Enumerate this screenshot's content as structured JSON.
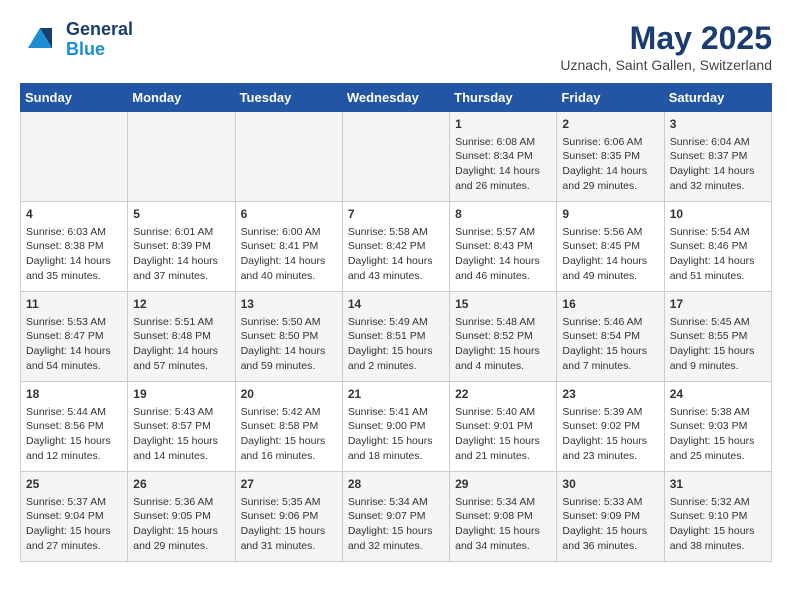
{
  "header": {
    "logo_line1": "General",
    "logo_line2": "Blue",
    "title": "May 2025",
    "subtitle": "Uznach, Saint Gallen, Switzerland"
  },
  "days_of_week": [
    "Sunday",
    "Monday",
    "Tuesday",
    "Wednesday",
    "Thursday",
    "Friday",
    "Saturday"
  ],
  "weeks": [
    [
      {
        "day": "",
        "content": ""
      },
      {
        "day": "",
        "content": ""
      },
      {
        "day": "",
        "content": ""
      },
      {
        "day": "",
        "content": ""
      },
      {
        "day": "1",
        "content": "Sunrise: 6:08 AM\nSunset: 8:34 PM\nDaylight: 14 hours\nand 26 minutes."
      },
      {
        "day": "2",
        "content": "Sunrise: 6:06 AM\nSunset: 8:35 PM\nDaylight: 14 hours\nand 29 minutes."
      },
      {
        "day": "3",
        "content": "Sunrise: 6:04 AM\nSunset: 8:37 PM\nDaylight: 14 hours\nand 32 minutes."
      }
    ],
    [
      {
        "day": "4",
        "content": "Sunrise: 6:03 AM\nSunset: 8:38 PM\nDaylight: 14 hours\nand 35 minutes."
      },
      {
        "day": "5",
        "content": "Sunrise: 6:01 AM\nSunset: 8:39 PM\nDaylight: 14 hours\nand 37 minutes."
      },
      {
        "day": "6",
        "content": "Sunrise: 6:00 AM\nSunset: 8:41 PM\nDaylight: 14 hours\nand 40 minutes."
      },
      {
        "day": "7",
        "content": "Sunrise: 5:58 AM\nSunset: 8:42 PM\nDaylight: 14 hours\nand 43 minutes."
      },
      {
        "day": "8",
        "content": "Sunrise: 5:57 AM\nSunset: 8:43 PM\nDaylight: 14 hours\nand 46 minutes."
      },
      {
        "day": "9",
        "content": "Sunrise: 5:56 AM\nSunset: 8:45 PM\nDaylight: 14 hours\nand 49 minutes."
      },
      {
        "day": "10",
        "content": "Sunrise: 5:54 AM\nSunset: 8:46 PM\nDaylight: 14 hours\nand 51 minutes."
      }
    ],
    [
      {
        "day": "11",
        "content": "Sunrise: 5:53 AM\nSunset: 8:47 PM\nDaylight: 14 hours\nand 54 minutes."
      },
      {
        "day": "12",
        "content": "Sunrise: 5:51 AM\nSunset: 8:48 PM\nDaylight: 14 hours\nand 57 minutes."
      },
      {
        "day": "13",
        "content": "Sunrise: 5:50 AM\nSunset: 8:50 PM\nDaylight: 14 hours\nand 59 minutes."
      },
      {
        "day": "14",
        "content": "Sunrise: 5:49 AM\nSunset: 8:51 PM\nDaylight: 15 hours\nand 2 minutes."
      },
      {
        "day": "15",
        "content": "Sunrise: 5:48 AM\nSunset: 8:52 PM\nDaylight: 15 hours\nand 4 minutes."
      },
      {
        "day": "16",
        "content": "Sunrise: 5:46 AM\nSunset: 8:54 PM\nDaylight: 15 hours\nand 7 minutes."
      },
      {
        "day": "17",
        "content": "Sunrise: 5:45 AM\nSunset: 8:55 PM\nDaylight: 15 hours\nand 9 minutes."
      }
    ],
    [
      {
        "day": "18",
        "content": "Sunrise: 5:44 AM\nSunset: 8:56 PM\nDaylight: 15 hours\nand 12 minutes."
      },
      {
        "day": "19",
        "content": "Sunrise: 5:43 AM\nSunset: 8:57 PM\nDaylight: 15 hours\nand 14 minutes."
      },
      {
        "day": "20",
        "content": "Sunrise: 5:42 AM\nSunset: 8:58 PM\nDaylight: 15 hours\nand 16 minutes."
      },
      {
        "day": "21",
        "content": "Sunrise: 5:41 AM\nSunset: 9:00 PM\nDaylight: 15 hours\nand 18 minutes."
      },
      {
        "day": "22",
        "content": "Sunrise: 5:40 AM\nSunset: 9:01 PM\nDaylight: 15 hours\nand 21 minutes."
      },
      {
        "day": "23",
        "content": "Sunrise: 5:39 AM\nSunset: 9:02 PM\nDaylight: 15 hours\nand 23 minutes."
      },
      {
        "day": "24",
        "content": "Sunrise: 5:38 AM\nSunset: 9:03 PM\nDaylight: 15 hours\nand 25 minutes."
      }
    ],
    [
      {
        "day": "25",
        "content": "Sunrise: 5:37 AM\nSunset: 9:04 PM\nDaylight: 15 hours\nand 27 minutes."
      },
      {
        "day": "26",
        "content": "Sunrise: 5:36 AM\nSunset: 9:05 PM\nDaylight: 15 hours\nand 29 minutes."
      },
      {
        "day": "27",
        "content": "Sunrise: 5:35 AM\nSunset: 9:06 PM\nDaylight: 15 hours\nand 31 minutes."
      },
      {
        "day": "28",
        "content": "Sunrise: 5:34 AM\nSunset: 9:07 PM\nDaylight: 15 hours\nand 32 minutes."
      },
      {
        "day": "29",
        "content": "Sunrise: 5:34 AM\nSunset: 9:08 PM\nDaylight: 15 hours\nand 34 minutes."
      },
      {
        "day": "30",
        "content": "Sunrise: 5:33 AM\nSunset: 9:09 PM\nDaylight: 15 hours\nand 36 minutes."
      },
      {
        "day": "31",
        "content": "Sunrise: 5:32 AM\nSunset: 9:10 PM\nDaylight: 15 hours\nand 38 minutes."
      }
    ]
  ]
}
